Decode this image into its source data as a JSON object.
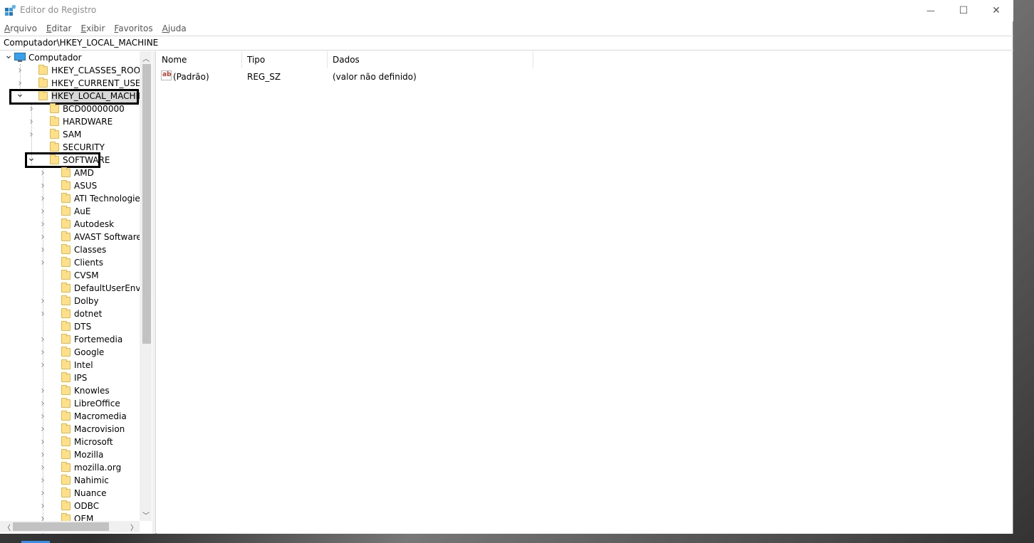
{
  "window": {
    "title": "Editor do Registro",
    "minimize_glyph": "—",
    "maximize_glyph": "☐",
    "close_glyph": "✕"
  },
  "menu": [
    {
      "underline": "A",
      "rest": "rquivo"
    },
    {
      "underline": "E",
      "rest": "ditar"
    },
    {
      "underline": "E",
      "rest": "xibir"
    },
    {
      "underline": "F",
      "rest": "avoritos"
    },
    {
      "underline": "A",
      "rest": "juda"
    }
  ],
  "address": "Computador\\HKEY_LOCAL_MACHINE",
  "tree": {
    "root": "Computador",
    "hives": [
      "HKEY_CLASSES_ROOT",
      "HKEY_CURRENT_USER",
      "HKEY_LOCAL_MACHINE"
    ],
    "hklm_children": [
      "BCD00000000",
      "HARDWARE",
      "SAM",
      "SECURITY",
      "SOFTWARE"
    ],
    "software_children": [
      "AMD",
      "ASUS",
      "ATI Technologies",
      "AuE",
      "Autodesk",
      "AVAST Software",
      "Classes",
      "Clients",
      "CVSM",
      "DefaultUserEnvironn",
      "Dolby",
      "dotnet",
      "DTS",
      "Fortemedia",
      "Google",
      "Intel",
      "IPS",
      "Knowles",
      "LibreOffice",
      "Macromedia",
      "Macrovision",
      "Microsoft",
      "Mozilla",
      "mozilla.org",
      "Nahimic",
      "Nuance",
      "ODBC",
      "OEM"
    ]
  },
  "list": {
    "columns": [
      "Nome",
      "Tipo",
      "Dados"
    ],
    "rows": [
      {
        "name": "(Padrão)",
        "type": "REG_SZ",
        "data": "(valor não definido)"
      }
    ],
    "value_icon_text": "ab"
  }
}
